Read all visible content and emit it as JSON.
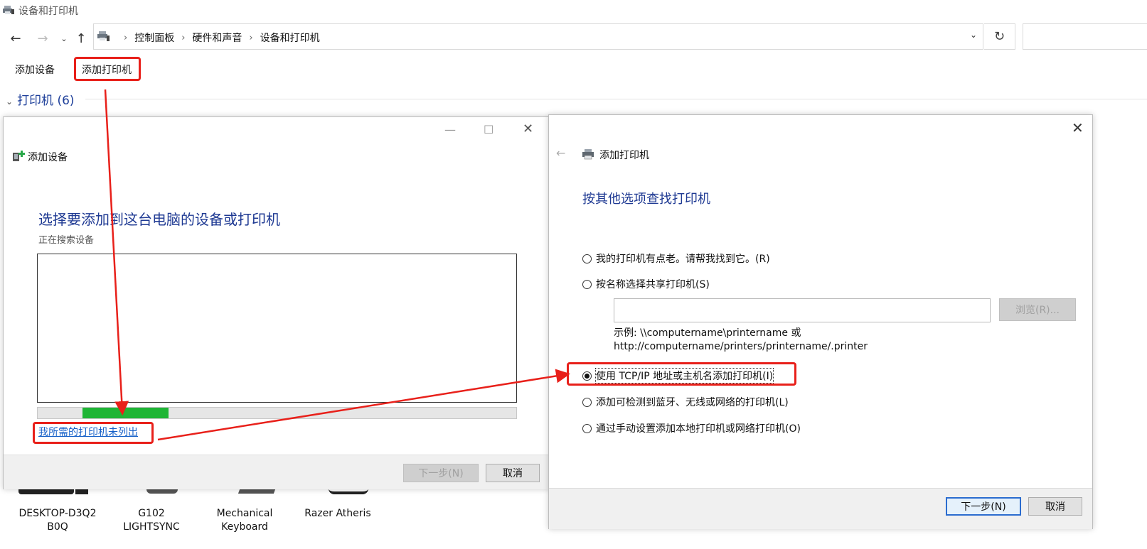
{
  "window": {
    "title": "设备和打印机"
  },
  "nav": {
    "breadcrumbs": [
      "控制面板",
      "硬件和声音",
      "设备和打印机"
    ]
  },
  "commands": {
    "add_device": "添加设备",
    "add_printer": "添加打印机"
  },
  "group": {
    "label": "打印机 (6)"
  },
  "devices": [
    {
      "name": "DESKTOP-D3Q2\nB0Q"
    },
    {
      "name": "G102\nLIGHTSYNC"
    },
    {
      "name": "Mechanical\nKeyboard"
    },
    {
      "name": "Razer Atheris"
    }
  ],
  "add_device_dialog": {
    "title": "添加设备",
    "heading": "选择要添加到这台电脑的设备或打印机",
    "status": "正在搜索设备",
    "progress": 0.3,
    "not_listed_link": "我所需的打印机未列出",
    "next_button": "下一步(N)",
    "cancel_button": "取消"
  },
  "add_printer_dialog": {
    "title": "添加打印机",
    "heading": "按其他选项查找打印机",
    "options": [
      {
        "label": "我的打印机有点老。请帮我找到它。(R)",
        "selected": false
      },
      {
        "label": "按名称选择共享打印机(S)",
        "selected": false
      },
      {
        "label": "使用 TCP/IP 地址或主机名添加打印机(I)",
        "selected": true
      },
      {
        "label": "添加可检测到蓝牙、无线或网络的打印机(L)",
        "selected": false
      },
      {
        "label": "通过手动设置添加本地打印机或网络打印机(O)",
        "selected": false
      }
    ],
    "browse_button": "浏览(R)...",
    "example_line1": "示例: \\\\computername\\printername 或",
    "example_line2": "http://computername/printers/printername/.printer",
    "next_button": "下一步(N)",
    "cancel_button": "取消"
  },
  "colors": {
    "annotation": "#e8201a",
    "heading": "#1f3a93",
    "progress": "#1fb535",
    "link": "#1560c8"
  }
}
